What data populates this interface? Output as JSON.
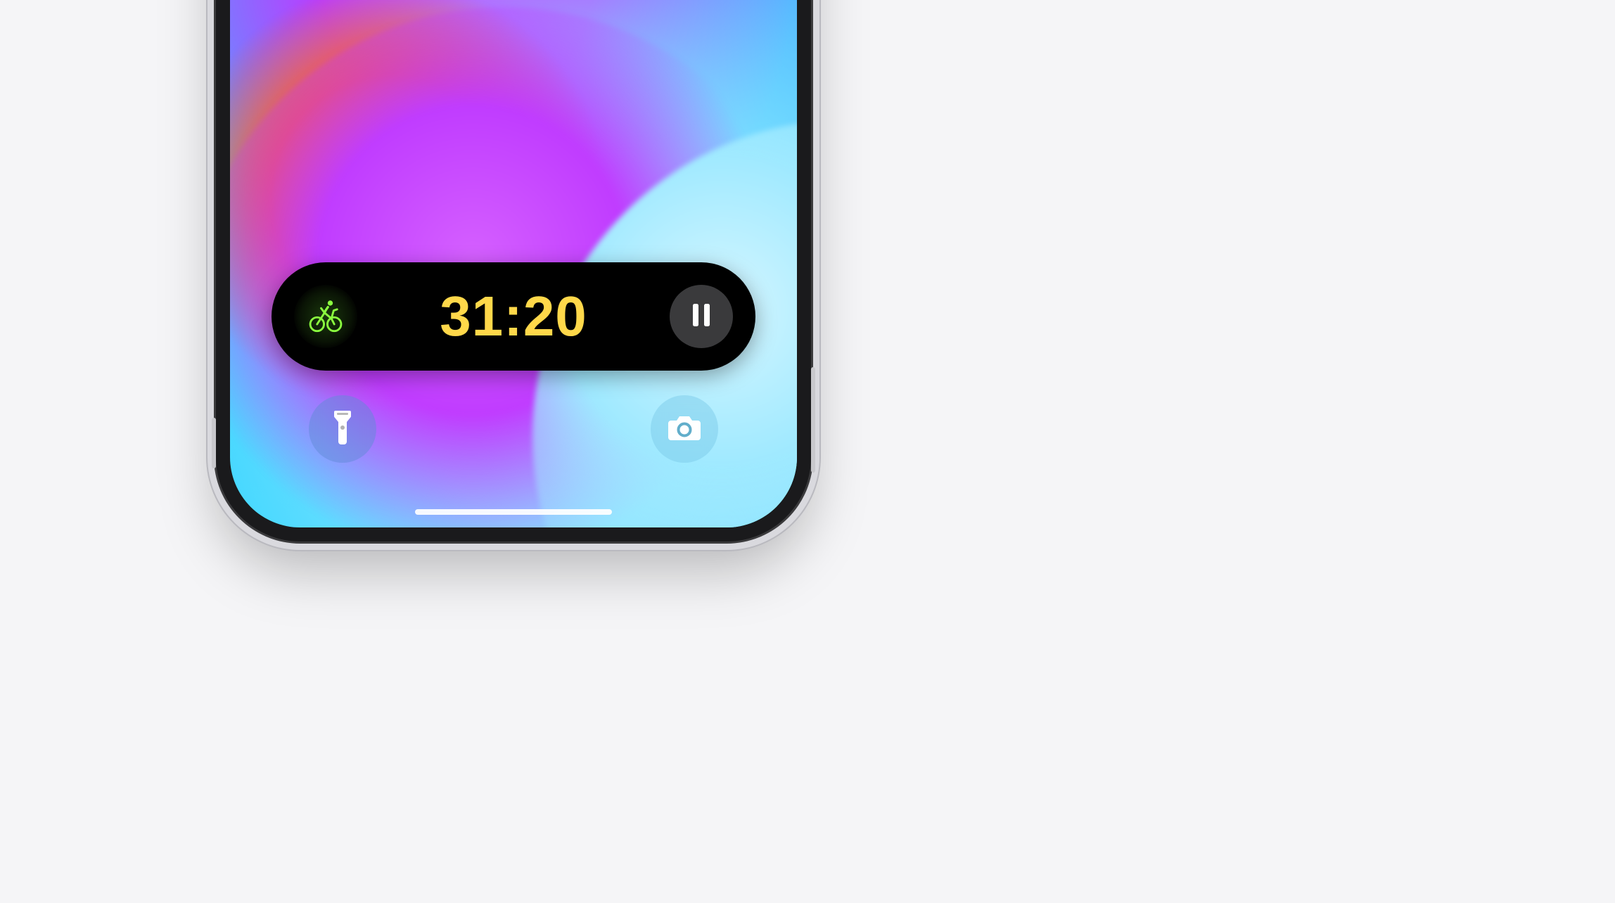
{
  "live_activity": {
    "workout_icon_name": "cycling-icon",
    "timer": "31:20",
    "timer_color": "#ffd84a",
    "pause_icon_name": "pause-icon"
  },
  "lock_screen": {
    "flashlight_icon_name": "flashlight-icon",
    "camera_icon_name": "camera-icon"
  },
  "colors": {
    "pill_bg": "#000000",
    "pause_bg": "#3a3a3c",
    "workout_accent": "#7dff3a"
  }
}
